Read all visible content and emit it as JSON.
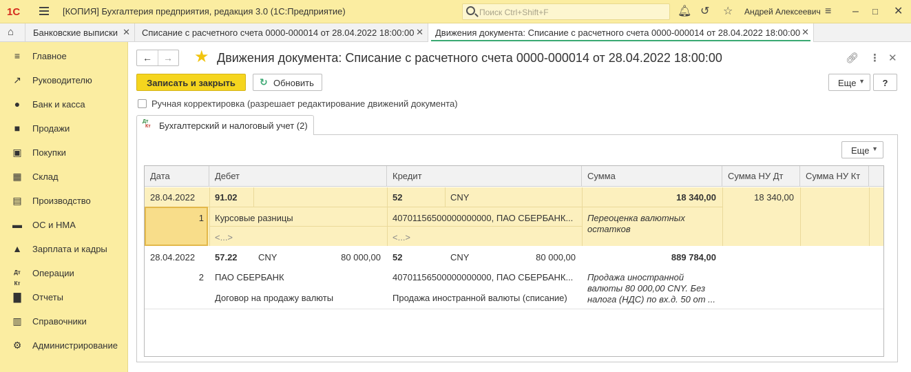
{
  "titlebar": {
    "logo": "1С",
    "app_title": "[КОПИЯ] Бухгалтерия предприятия, редакция 3.0  (1С:Предприятие)",
    "search_placeholder": "Поиск Ctrl+Shift+F",
    "user": "Андрей Алексеевич"
  },
  "tabs": [
    {
      "label": "Банковские выписки"
    },
    {
      "label": "Списание с расчетного счета 0000-000014 от 28.04.2022 18:00:00"
    },
    {
      "label": "Движения документа: Списание с расчетного счета 0000-000014 от 28.04.2022 18:00:00"
    }
  ],
  "sidebar": {
    "items": [
      {
        "label": "Главное",
        "icon": "menu-icon"
      },
      {
        "label": "Руководителю",
        "icon": "trend-icon"
      },
      {
        "label": "Банк и касса",
        "icon": "coin-icon"
      },
      {
        "label": "Продажи",
        "icon": "bag-icon"
      },
      {
        "label": "Покупки",
        "icon": "cart-icon"
      },
      {
        "label": "Склад",
        "icon": "warehouse-icon"
      },
      {
        "label": "Производство",
        "icon": "factory-icon"
      },
      {
        "label": "ОС и НМА",
        "icon": "truck-icon"
      },
      {
        "label": "Зарплата и кадры",
        "icon": "person-icon"
      },
      {
        "label": "Операции",
        "icon": "dt-kt-icon"
      },
      {
        "label": "Отчеты",
        "icon": "bar-chart-icon"
      },
      {
        "label": "Справочники",
        "icon": "book-icon"
      },
      {
        "label": "Администрирование",
        "icon": "gear-icon"
      }
    ]
  },
  "main": {
    "title": "Движения документа: Списание с расчетного счета 0000-000014 от 28.04.2022 18:00:00",
    "save_close": "Записать и закрыть",
    "refresh": "Обновить",
    "more": "Еще",
    "help": "?",
    "manual_adjust": "Ручная корректировка (разрешает редактирование движений документа)",
    "tab_label": "Бухгалтерский и налоговый учет (2)",
    "tab_icon_dt": "Дт",
    "tab_icon_kt": "Кт",
    "grid_more": "Еще"
  },
  "table": {
    "columns": [
      "Дата",
      "Дебет",
      "Кредит",
      "Сумма",
      "Сумма НУ Дт",
      "Сумма НУ Кт"
    ],
    "rows": [
      {
        "date": "28.04.2022",
        "num": "1",
        "debit_account": "91.02",
        "debit_sub1": "Курсовые разницы",
        "debit_sub2": "<...>",
        "credit_account": "52",
        "credit_currency": "CNY",
        "credit_sub1": "40701156500000000000, ПАО СБЕРБАНК...",
        "credit_sub2": "<...>",
        "amount": "18 340,00",
        "content": "Переоценка валютных остатков",
        "nu_dt": "18 340,00"
      },
      {
        "date": "28.04.2022",
        "num": "2",
        "debit_account": "57.22",
        "debit_currency": "CNY",
        "debit_cur_amount": "80 000,00",
        "debit_sub1": "ПАО СБЕРБАНК",
        "debit_sub2": "Договор на продажу валюты",
        "credit_account": "52",
        "credit_currency": "CNY",
        "credit_cur_amount": "80 000,00",
        "credit_sub1": "40701156500000000000, ПАО СБЕРБАНК...",
        "credit_sub2": "Продажа иностранной валюты (списание)",
        "amount": "889 784,00",
        "content": "Продажа иностранной валюты 80 000,00 CNY. Без налога (НДС) по вх.д. 50 от ..."
      }
    ]
  }
}
